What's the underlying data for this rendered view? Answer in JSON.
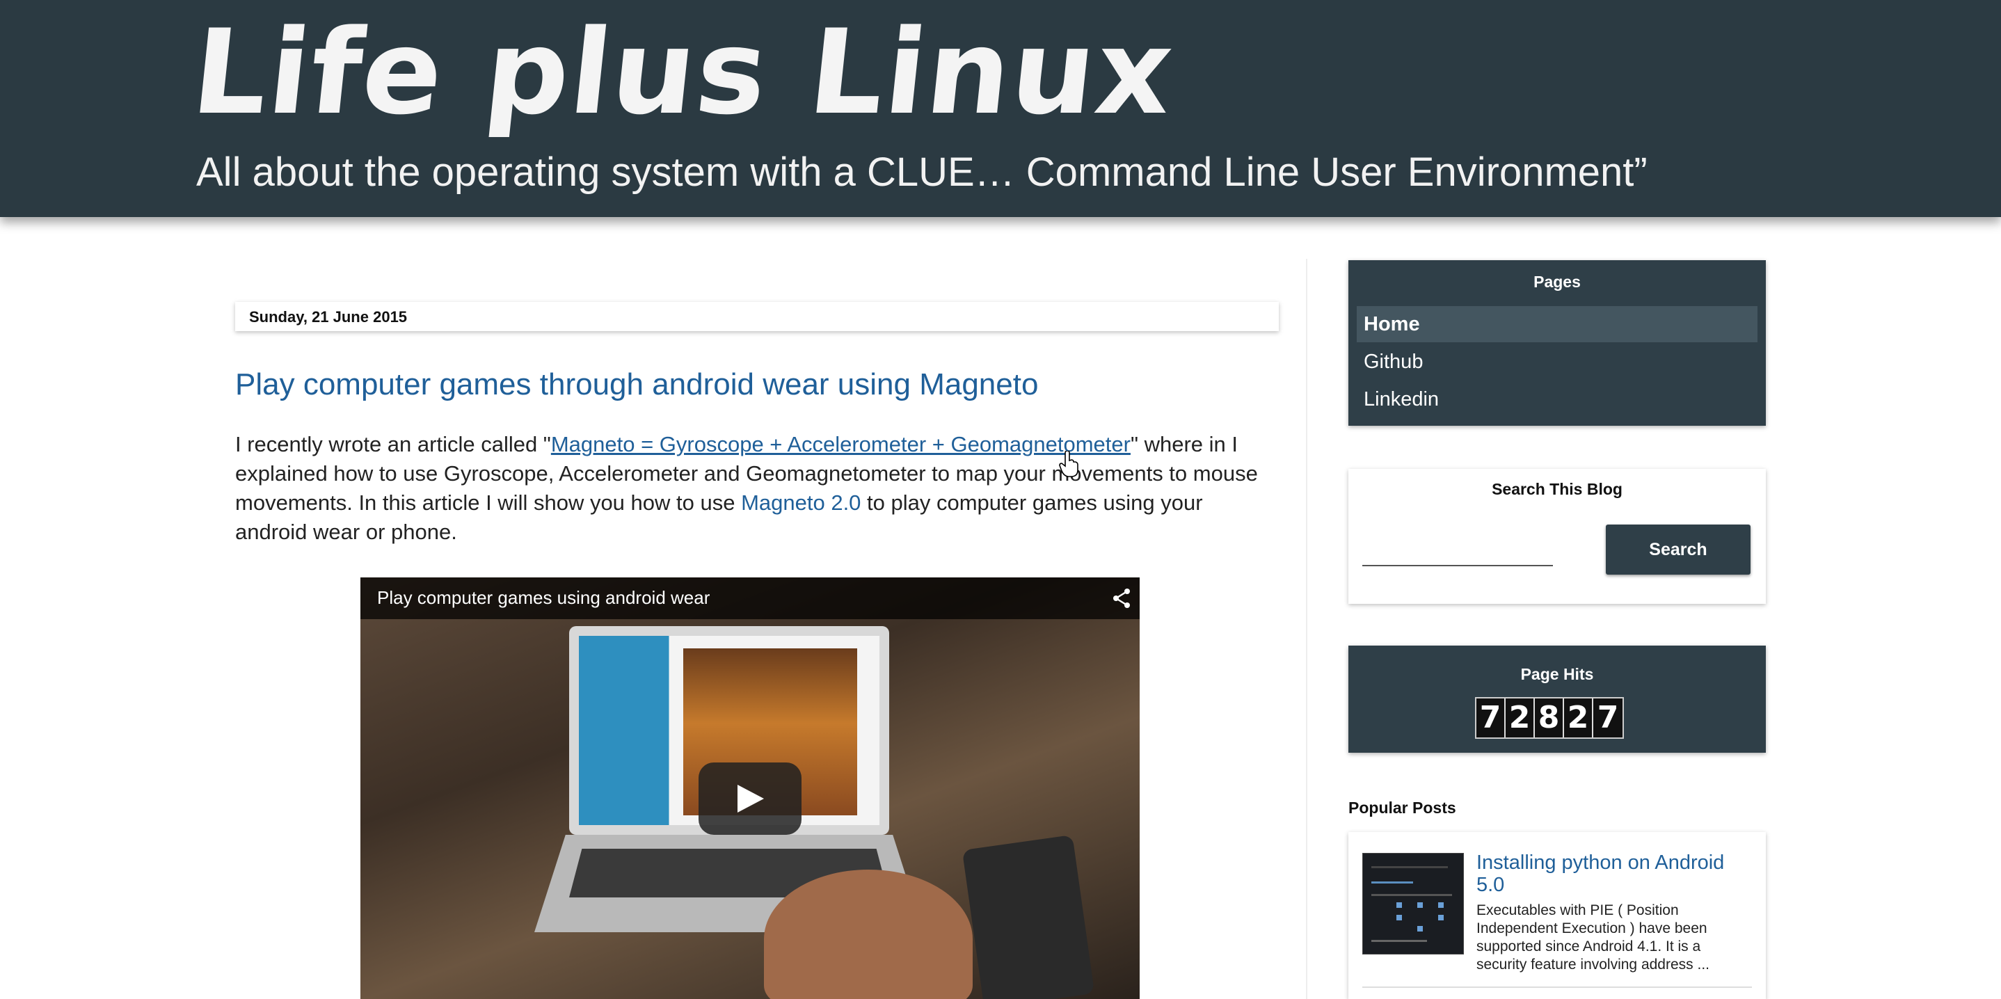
{
  "header": {
    "title": "Life plus Linux",
    "description": "All about the operating system with a CLUE… Command Line User Environment”"
  },
  "post": {
    "date": "Sunday, 21 June 2015",
    "title": "Play computer games through android wear using Magneto",
    "body_intro": "I recently wrote an article called \"",
    "link_article": "Magneto = Gyroscope + Accelerometer + Geomagnetometer",
    "body_mid": "\" where in I explained how to use Gyroscope, Accelerometer and Geomagnetometer to map your movements to mouse movements. In this article I will show you how to use ",
    "link_magneto": "Magneto 2.0",
    "body_end": " to play computer games using your android wear or phone.",
    "video": {
      "title": "Play computer games using android wear",
      "share_icon": "share-icon",
      "play_icon": "play-icon"
    }
  },
  "sidebar": {
    "pages": {
      "title": "Pages",
      "items": [
        {
          "label": "Home",
          "active": true
        },
        {
          "label": "Github",
          "active": false
        },
        {
          "label": "Linkedin",
          "active": false
        }
      ]
    },
    "search": {
      "title": "Search This Blog",
      "input_value": "",
      "button_label": "Search"
    },
    "page_hits": {
      "title": "Page Hits",
      "digits": [
        "7",
        "2",
        "8",
        "2",
        "7"
      ]
    },
    "popular_posts": {
      "title": "Popular Posts",
      "items": [
        {
          "title": "Installing python on Android 5.0",
          "snippet": "Executables with PIE ( Position Independent Execution ) have been supported since Android 4.1. It is a security feature involving address ..."
        }
      ]
    }
  },
  "colors": {
    "header_bg": "#2b3a42",
    "widget_bg": "#2f3f48",
    "link": "#1f5f99"
  }
}
